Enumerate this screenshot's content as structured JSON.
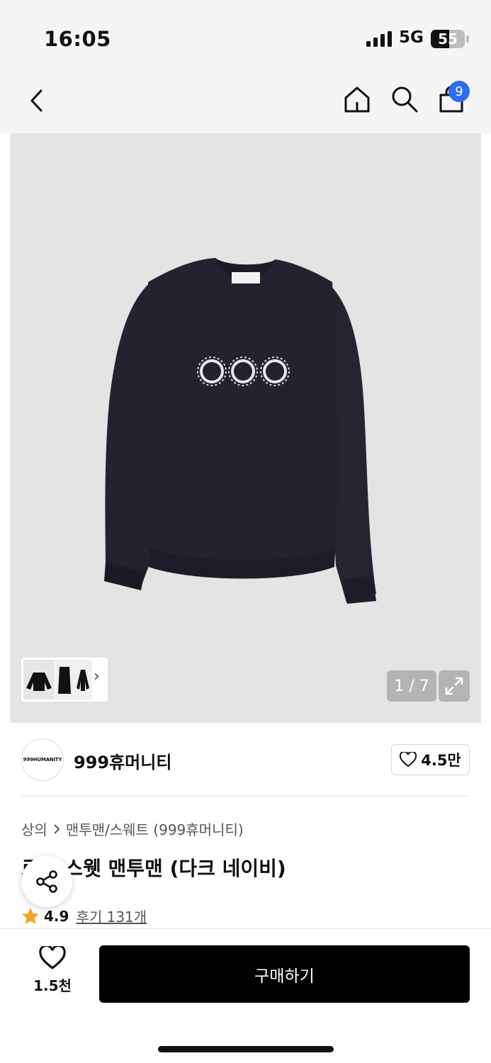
{
  "status_bar": {
    "time": "16:05",
    "network": "5G",
    "battery": "55",
    "battery_level": 0.55
  },
  "nav": {
    "back_icon": "chevron-left-icon",
    "home_icon": "home-icon",
    "search_icon": "search-icon",
    "cart_icon": "shopping-bag-icon",
    "cart_count": "9"
  },
  "gallery": {
    "page_counter": "1 / 7",
    "current_page": 1,
    "total_pages": 7,
    "thumbnail_chevron": "›",
    "expand_icon": "expand-icon",
    "background_color": "#e4e4e4",
    "garment_color": "#23232f",
    "print_label": "999 embroidered logo"
  },
  "brand": {
    "logo_text": "999HUMANITY",
    "name": "999휴머니티",
    "likes": "4.5만"
  },
  "product": {
    "breadcrumb": [
      "상의",
      "맨투맨/스웨트 (999휴머니티)"
    ],
    "title": "로고 스웻 맨투맨 (다크 네이비)",
    "rating": "4.9",
    "reviews": "후기 131개"
  },
  "bottom_bar": {
    "wish_count": "1.5천",
    "buy_label": "구매하기"
  },
  "colors": {
    "accent_blue": "#2f6cf6",
    "star": "#f5a623",
    "buy_button": "#000000"
  }
}
